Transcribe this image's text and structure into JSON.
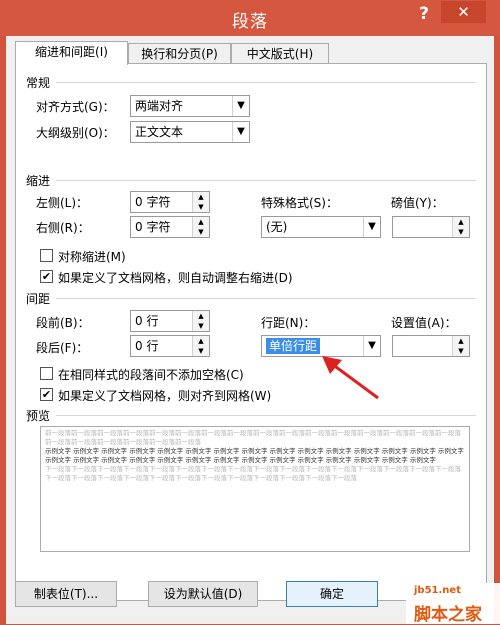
{
  "window": {
    "title": "段落",
    "help": "?",
    "close": "✕"
  },
  "tabs": [
    {
      "label": "缩进和间距(I)"
    },
    {
      "label": "换行和分页(P)"
    },
    {
      "label": "中文版式(H)"
    }
  ],
  "general": {
    "title": "常规",
    "alignment_label": "对齐方式(G)：",
    "alignment_value": "两端对齐",
    "outline_label": "大纲级别(O)：",
    "outline_value": "正文文本"
  },
  "indent": {
    "title": "缩进",
    "left_label": "左侧(L)：",
    "left_value": "0 字符",
    "right_label": "右侧(R)：",
    "right_value": "0 字符",
    "special_label": "特殊格式(S)：",
    "special_value": "(无)",
    "amount_label": "磅值(Y)：",
    "amount_value": "",
    "mirror_label": "对称缩进(M)",
    "auto_adjust_label": "如果定义了文档网格，则自动调整右缩进(D)"
  },
  "spacing": {
    "title": "间距",
    "before_label": "段前(B)：",
    "before_value": "0 行",
    "after_label": "段后(F)：",
    "after_value": "0 行",
    "line_spacing_label": "行距(N)：",
    "line_spacing_value": "单倍行距",
    "at_label": "设置值(A)：",
    "at_value": "",
    "no_space_label": "在相同样式的段落间不添加空格(C)",
    "snap_grid_label": "如果定义了文档网格，则对齐到网格(W)"
  },
  "preview": {
    "title": "预览",
    "prev_para": "前一段落前一段落前一段落前一段落前一段落前一段落前一段落前一段落前一段落前一段落前一段落前一段落前一段落前一段落前一段落前一段落前一段落前一段落前一段落前一段落前一段落前一段落",
    "sample": "示例文字 示例文字 示例文字 示例文字 示例文字 示例文字 示例文字 示例文字 示例文字 示例文字 示例文字 示例文字 示例文字 示例文字 示例文字 示例文字 示例文字 示例文字 示例文字 示例文字 示例文字 示例文字 示例文字 示例文字 示例文字 示例文字 示例文字 示例文字 示例文字",
    "next_para": "下一段落下一段落下一段落下一段落下一段落下一段落下一段落下一段落下一段落下一段落下一段落下一段落下一段落下一段落下一段落下一段落下一段落下一段落下一段落下一段落下一段落下一段落下一段落下一段落下一段落下一段落下一段落下一段落"
  },
  "buttons": {
    "tabs_button": "制表位(T)...",
    "default_button": "设为默认值(D)",
    "ok_button": "确定"
  },
  "watermark": {
    "site": "jb51.net",
    "home": "脚本之家"
  },
  "colors": {
    "titlebar": "#d6573f",
    "arrow": "#e02020",
    "selection": "#3b8ee8"
  }
}
